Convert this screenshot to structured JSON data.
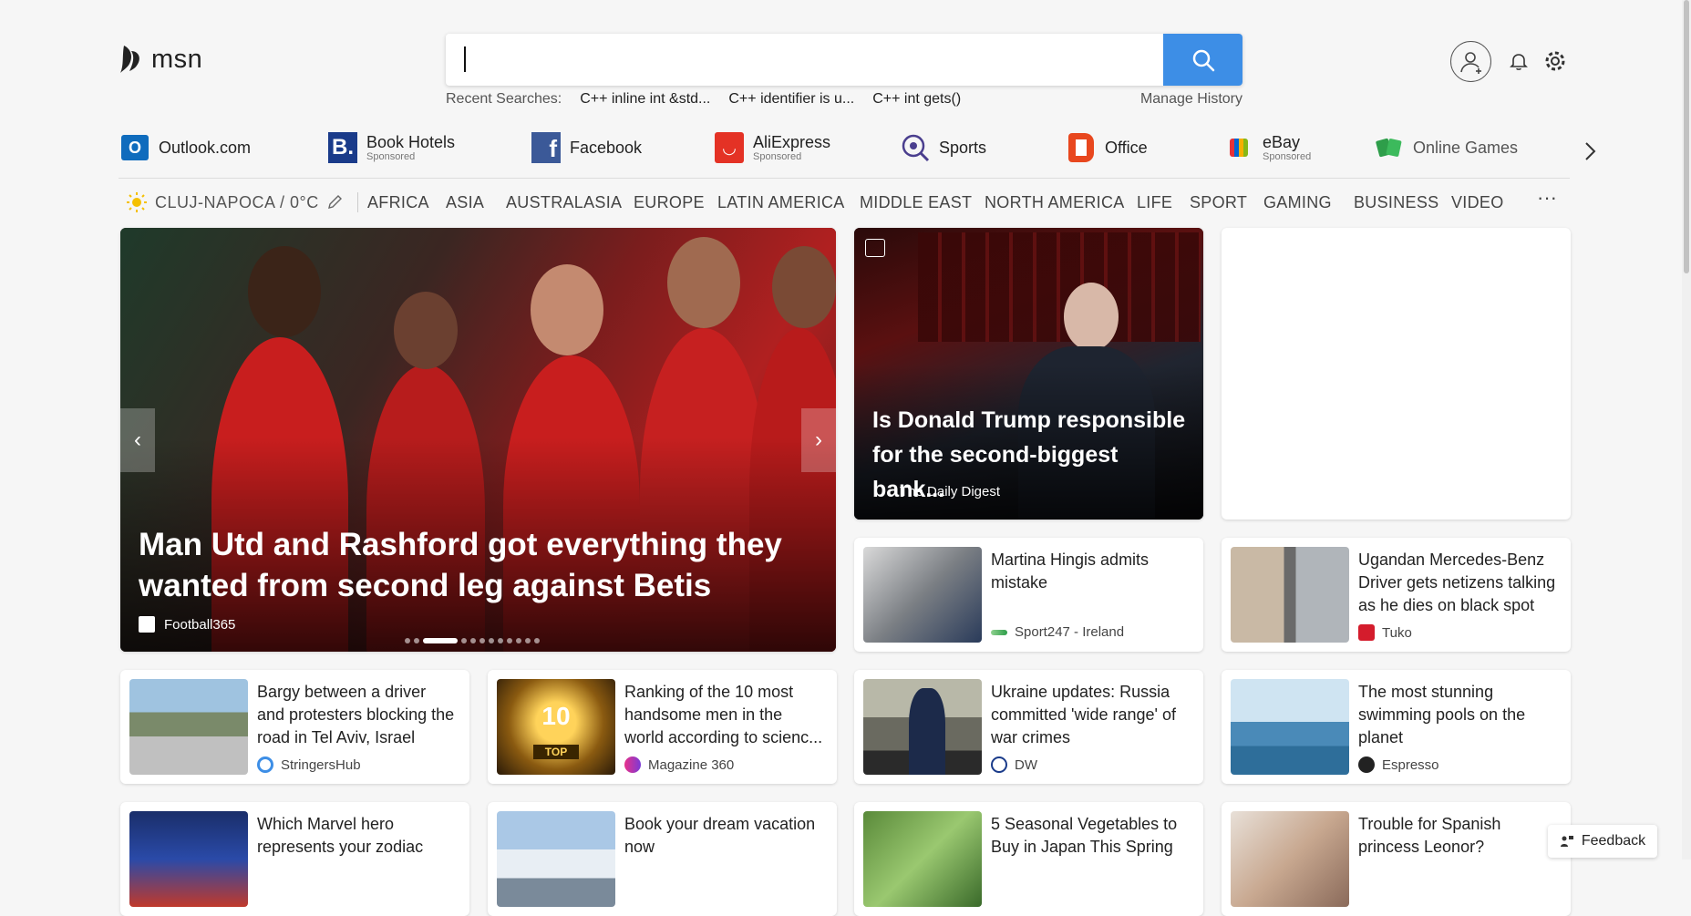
{
  "header": {
    "logo_text": "msn",
    "search": {
      "value": "",
      "placeholder": ""
    },
    "recent_label": "Recent Searches:",
    "recent": [
      "C++ inline int &std...",
      "C++ identifier is u...",
      "C++ int gets()"
    ],
    "manage_history": "Manage History"
  },
  "quicklinks": [
    {
      "name": "Outlook.com",
      "sponsored": "",
      "icon": "outlook-icon",
      "color": "#0f6cbd"
    },
    {
      "name": "Book Hotels",
      "sponsored": "Sponsored",
      "icon": "booking-icon",
      "color": "#1a3b8a"
    },
    {
      "name": "Facebook",
      "sponsored": "",
      "icon": "facebook-icon",
      "color": "#3b5998"
    },
    {
      "name": "AliExpress",
      "sponsored": "Sponsored",
      "icon": "aliexpress-icon",
      "color": "#e43225"
    },
    {
      "name": "Sports",
      "sponsored": "",
      "icon": "sports-icon",
      "color": "#4a3e8e"
    },
    {
      "name": "Office",
      "sponsored": "",
      "icon": "office-icon",
      "color": "#e8471e"
    },
    {
      "name": "eBay",
      "sponsored": "Sponsored",
      "icon": "ebay-icon",
      "color": "#333333"
    },
    {
      "name": "Online Games",
      "sponsored": "",
      "icon": "games-icon",
      "color": "#2e9e4a"
    }
  ],
  "nav": {
    "weather": "CLUJ-NAPOCA / 0°C",
    "items": [
      "AFRICA",
      "ASIA",
      "AUSTRALASIA",
      "EUROPE",
      "LATIN AMERICA",
      "MIDDLE EAST",
      "NORTH AMERICA",
      "LIFE",
      "SPORT",
      "GAMING",
      "BUSINESS",
      "VIDEO"
    ],
    "more": "···"
  },
  "hero": {
    "title": "Man Utd and Rashford got everything they wanted from second leg against Betis",
    "source": "Football365",
    "prev": "‹",
    "next": "›"
  },
  "trump": {
    "title": "Is Donald Trump responsible for the second-biggest bank...",
    "source": "The Daily Digest"
  },
  "cards": [
    {
      "title": "Martina Hingis admits mistake",
      "source": "Sport247 - Ireland"
    },
    {
      "title": "Ugandan Mercedes-Benz Driver gets netizens talking as he dies on black spot",
      "source": "Tuko"
    },
    {
      "title": "Bargy between a driver and protesters blocking the road in Tel Aviv, Israel",
      "source": "StringersHub"
    },
    {
      "title": "Ranking of the 10 most handsome men in the world according to scienc...",
      "source": "Magazine 360"
    },
    {
      "title": "Ukraine updates: Russia committed 'wide range' of war crimes",
      "source": "DW"
    },
    {
      "title": "The most stunning swimming pools on the planet",
      "source": "Espresso"
    },
    {
      "title": "Which Marvel hero represents your zodiac",
      "source": ""
    },
    {
      "title": "Book your dream vacation now",
      "source": ""
    },
    {
      "title": "5 Seasonal Vegetables to Buy in Japan This Spring",
      "source": ""
    },
    {
      "title": "Trouble for Spanish princess Leonor?",
      "source": ""
    }
  ],
  "badge_10": "10",
  "badge_top": "TOP",
  "feedback": "Feedback"
}
